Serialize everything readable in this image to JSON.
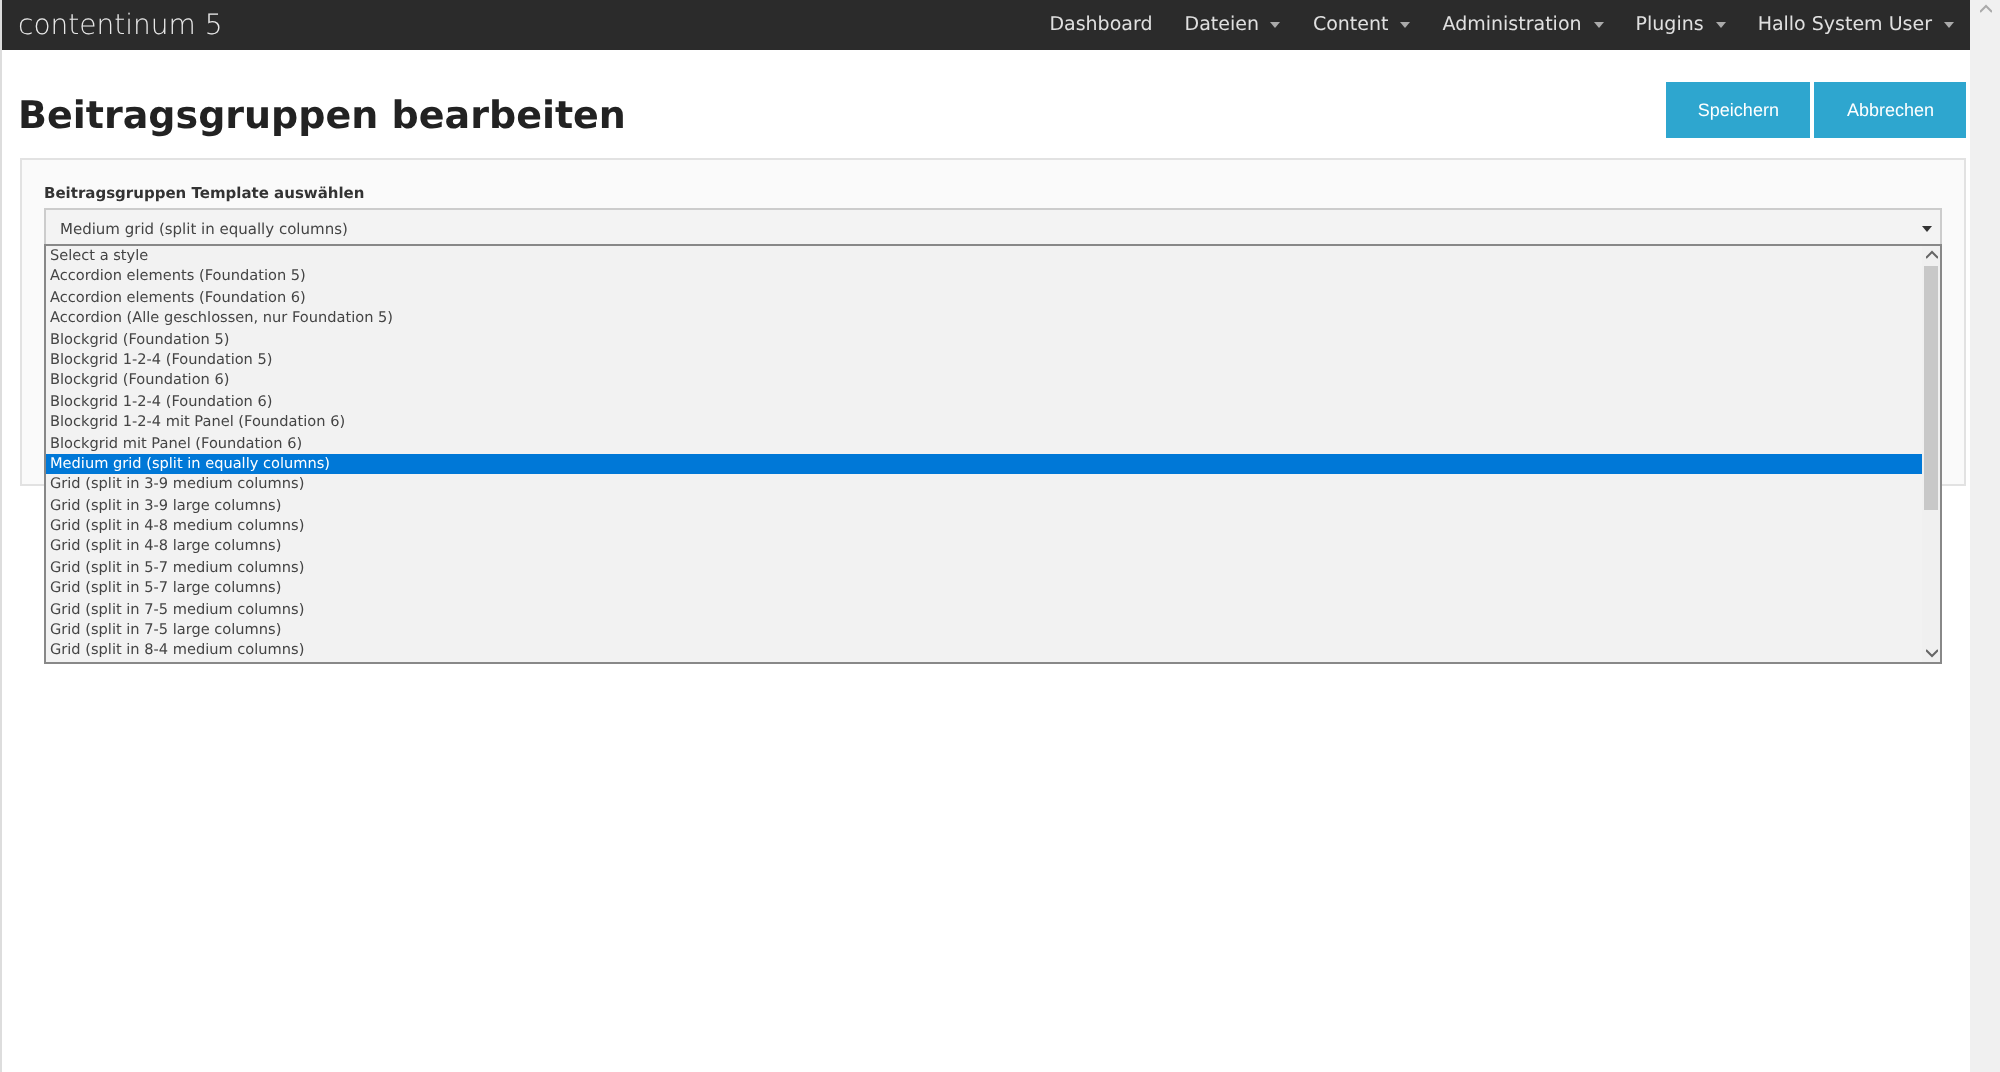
{
  "navbar": {
    "brand": "contentinum 5",
    "items": [
      {
        "label": "Dashboard",
        "has_menu": false
      },
      {
        "label": "Dateien",
        "has_menu": true
      },
      {
        "label": "Content",
        "has_menu": true
      },
      {
        "label": "Administration",
        "has_menu": true
      },
      {
        "label": "Plugins",
        "has_menu": true
      },
      {
        "label": "Hallo System User",
        "has_menu": true
      }
    ]
  },
  "page": {
    "title": "Beitragsgruppen bearbeiten",
    "buttons": [
      "Speichern",
      "Abbrechen"
    ]
  },
  "form": {
    "label": "Beitragsgruppen Template auswählen",
    "value": "Medium grid (split in equally columns)",
    "options": [
      {
        "label": "Select a style",
        "selected": false
      },
      {
        "label": "Accordion elements (Foundation 5)",
        "selected": false
      },
      {
        "label": "Accordion elements (Foundation 6)",
        "selected": false
      },
      {
        "label": "Accordion (Alle geschlossen, nur Foundation 5)",
        "selected": false
      },
      {
        "label": "Blockgrid (Foundation 5)",
        "selected": false
      },
      {
        "label": "Blockgrid 1-2-4 (Foundation 5)",
        "selected": false
      },
      {
        "label": "Blockgrid (Foundation 6)",
        "selected": false
      },
      {
        "label": "Blockgrid 1-2-4 (Foundation 6)",
        "selected": false
      },
      {
        "label": "Blockgrid 1-2-4 mit Panel (Foundation 6)",
        "selected": false
      },
      {
        "label": "Blockgrid mit Panel (Foundation 6)",
        "selected": false
      },
      {
        "label": "Medium grid (split in equally columns)",
        "selected": true
      },
      {
        "label": "Grid (split in 3-9 medium columns)",
        "selected": false
      },
      {
        "label": "Grid (split in 3-9 large columns)",
        "selected": false
      },
      {
        "label": "Grid (split in 4-8 medium columns)",
        "selected": false
      },
      {
        "label": "Grid (split in 4-8 large columns)",
        "selected": false
      },
      {
        "label": "Grid (split in 5-7 medium columns)",
        "selected": false
      },
      {
        "label": "Grid (split in 5-7 large columns)",
        "selected": false
      },
      {
        "label": "Grid (split in 7-5 medium columns)",
        "selected": false
      },
      {
        "label": "Grid (split in 7-5 large columns)",
        "selected": false
      },
      {
        "label": "Grid (split in 8-4 medium columns)",
        "selected": false
      }
    ]
  }
}
